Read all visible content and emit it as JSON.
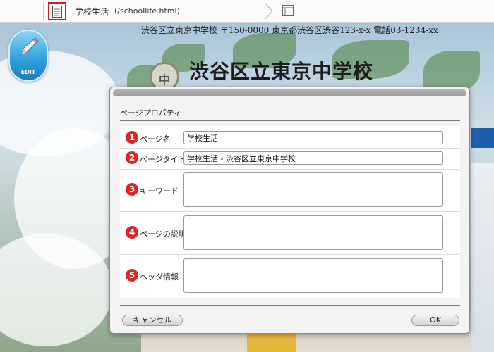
{
  "topbar": {
    "page_name": "学校生活",
    "page_path": "(/schoollife.html)",
    "icons": [
      "page-icon",
      "chevron-right-icon",
      "layout-icon"
    ]
  },
  "background": {
    "address": "渋谷区立東京中学校 〒150-0000 東京都渋谷区渋谷123-x-x 電話03-1234-xx",
    "school_name": "渋谷区立東京中学校",
    "crest_char": "中"
  },
  "edit_button": {
    "label": "EDIT",
    "icon": "pencil-icon"
  },
  "dialog": {
    "title": "ページプロパティ",
    "fields": [
      {
        "number": "1",
        "label": "ページ名",
        "value": "学校生活",
        "type": "text"
      },
      {
        "number": "2",
        "label": "ページタイトル",
        "value": "学校生活 - 渋谷区立東京中学校",
        "type": "text"
      },
      {
        "number": "3",
        "label": "キーワード",
        "value": "",
        "type": "textarea"
      },
      {
        "number": "4",
        "label": "ページの説明",
        "value": "",
        "type": "textarea"
      },
      {
        "number": "5",
        "label": "ヘッダ情報",
        "value": "",
        "type": "textarea"
      }
    ],
    "cancel_label": "キャンセル",
    "ok_label": "OK"
  },
  "colors": {
    "accent_red": "#d8282a",
    "highlight_border": "#d21c1c",
    "edit_blue": "#2f9ed8"
  }
}
